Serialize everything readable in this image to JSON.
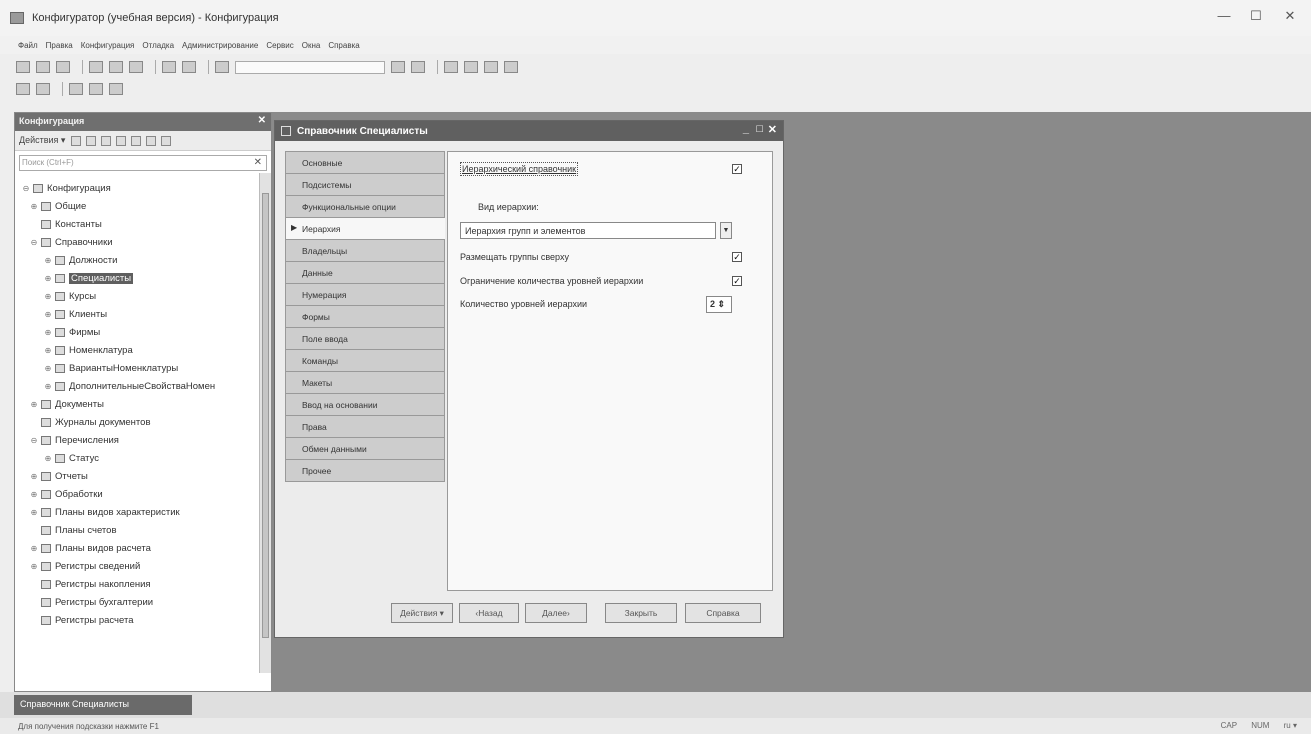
{
  "window": {
    "title": "Конфигуратор (учебная версия) - Конфигурация",
    "minimize": "—",
    "maximize": "☐",
    "close": "✕"
  },
  "menu": [
    "Файл",
    "Правка",
    "Конфигурация",
    "Отладка",
    "Администрирование",
    "Сервис",
    "Окна",
    "Справка"
  ],
  "tree": {
    "header": "Конфигурация",
    "actions_label": "Действия ▾",
    "search_placeholder": "Поиск (Ctrl+F)",
    "close": "✕",
    "items": [
      {
        "label": "Конфигурация",
        "expander": "⊖",
        "level": 0
      },
      {
        "label": "Общие",
        "expander": "⊕",
        "level": 1
      },
      {
        "label": "Константы",
        "expander": "",
        "level": 1
      },
      {
        "label": "Справочники",
        "expander": "⊖",
        "level": 1
      },
      {
        "label": "Должности",
        "expander": "⊕",
        "level": 2
      },
      {
        "label": "Специалисты",
        "expander": "⊕",
        "level": 2,
        "selected": true
      },
      {
        "label": "Курсы",
        "expander": "⊕",
        "level": 2
      },
      {
        "label": "Клиенты",
        "expander": "⊕",
        "level": 2
      },
      {
        "label": "Фирмы",
        "expander": "⊕",
        "level": 2
      },
      {
        "label": "Номенклатура",
        "expander": "⊕",
        "level": 2
      },
      {
        "label": "ВариантыНоменклатуры",
        "expander": "⊕",
        "level": 2
      },
      {
        "label": "ДополнительныеСвойстваНомен",
        "expander": "⊕",
        "level": 2
      },
      {
        "label": "Документы",
        "expander": "⊕",
        "level": 1
      },
      {
        "label": "Журналы документов",
        "expander": "",
        "level": 1
      },
      {
        "label": "Перечисления",
        "expander": "⊖",
        "level": 1
      },
      {
        "label": "Статус",
        "expander": "⊕",
        "level": 2
      },
      {
        "label": "Отчеты",
        "expander": "⊕",
        "level": 1
      },
      {
        "label": "Обработки",
        "expander": "⊕",
        "level": 1
      },
      {
        "label": "Планы видов характеристик",
        "expander": "⊕",
        "level": 1
      },
      {
        "label": "Планы счетов",
        "expander": "",
        "level": 1
      },
      {
        "label": "Планы видов расчета",
        "expander": "⊕",
        "level": 1
      },
      {
        "label": "Регистры сведений",
        "expander": "⊕",
        "level": 1
      },
      {
        "label": "Регистры накопления",
        "expander": "",
        "level": 1
      },
      {
        "label": "Регистры бухгалтерии",
        "expander": "",
        "level": 1
      },
      {
        "label": "Регистры расчета",
        "expander": "",
        "level": 1
      }
    ]
  },
  "dialog": {
    "title": "Справочник Специалисты",
    "min": "_",
    "max": "□",
    "close": "✕",
    "nav": [
      {
        "label": "Основные"
      },
      {
        "label": "Подсистемы"
      },
      {
        "label": "Функциональные опции"
      },
      {
        "label": "Иерархия",
        "active": true,
        "arrow": "▶"
      },
      {
        "label": "Владельцы"
      },
      {
        "label": "Данные"
      },
      {
        "label": "Нумерация"
      },
      {
        "label": "Формы"
      },
      {
        "label": "Поле ввода"
      },
      {
        "label": "Команды"
      },
      {
        "label": "Макеты"
      },
      {
        "label": "Ввод на основании"
      },
      {
        "label": "Права"
      },
      {
        "label": "Обмен данными"
      },
      {
        "label": "Прочее"
      }
    ],
    "hierarchical_label": "Иерархический справочник",
    "hierarchy_type_label": "Вид иерархии:",
    "hierarchy_type_value": "Иерархия групп и элементов",
    "groups_on_top_label": "Размещать группы сверху",
    "limit_levels_label": "Ограничение количества уровней иерархии",
    "levels_count_label": "Количество уровней иерархии",
    "levels_count_value": "2",
    "checked": "✓",
    "buttons": {
      "actions": "Действия ▾",
      "back": "‹Назад",
      "next": "Далее›",
      "close": "Закрыть",
      "help": "Справка"
    }
  },
  "taskbar": {
    "tab": "Справочник Специалисты"
  },
  "status": {
    "hint": "Для получения подсказки нажмите F1",
    "cap": "CAP",
    "num": "NUM",
    "lang": "ru ▾"
  }
}
